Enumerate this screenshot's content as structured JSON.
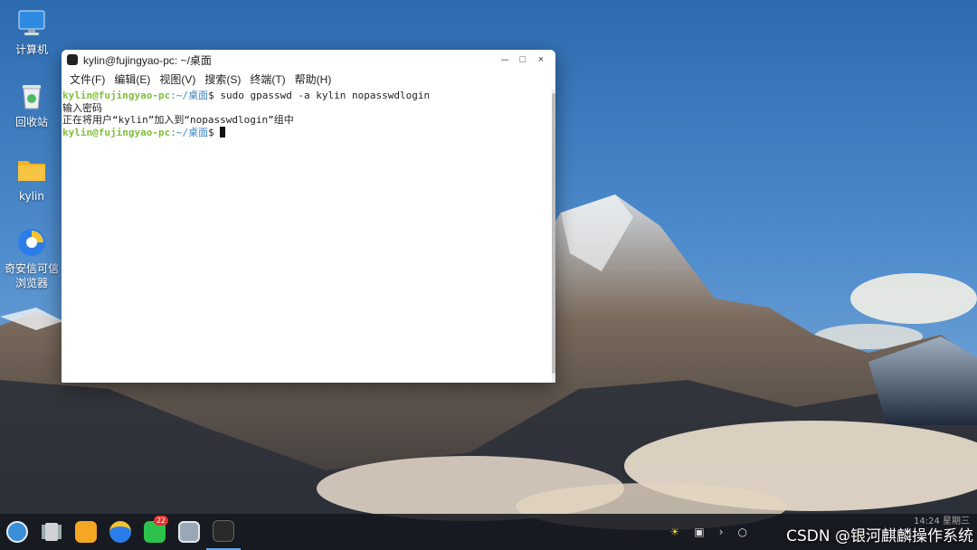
{
  "desktop": {
    "icons": [
      {
        "label": "计算机",
        "icon": "computer-icon"
      },
      {
        "label": "回收站",
        "icon": "trash-icon"
      },
      {
        "label": "kylin",
        "icon": "folder-icon"
      },
      {
        "label": "奇安信可信",
        "label2": "浏览器",
        "icon": "browser-icon"
      }
    ]
  },
  "window": {
    "title": "kylin@fujingyao-pc: ~/桌面",
    "controls": {
      "minimize": "－",
      "maximize": "□",
      "close": "×"
    },
    "menu": [
      "文件(F)",
      "编辑(E)",
      "视图(V)",
      "搜索(S)",
      "终端(T)",
      "帮助(H)"
    ]
  },
  "terminal": {
    "prompt_user": "kylin@fujingyao-pc",
    "prompt_path": ":~/桌面",
    "prompt_suffix": "$ ",
    "command": "sudo gpasswd -a kylin nopasswdlogin",
    "output_1": "输入密码",
    "output_2": "正在将用户“kylin”加入到“nopasswdlogin”组中"
  },
  "taskbar": {
    "apps": [
      {
        "name": "start-menu-icon",
        "color": "#3a8fd8"
      },
      {
        "name": "multitask-view-icon",
        "color": "#cfd3d8"
      },
      {
        "name": "file-manager-icon",
        "color": "#f5a623"
      },
      {
        "name": "browser-icon",
        "color": "#2b7de9"
      },
      {
        "name": "wechat-icon",
        "color": "#2dc24b",
        "badge": "22"
      },
      {
        "name": "image-viewer-icon",
        "color": "#9aa8b6"
      },
      {
        "name": "terminal-icon",
        "color": "#2a2a2a"
      }
    ],
    "clock_time": "14:24 星期三",
    "watermark": "CSDN @银河麒麟操作系统"
  }
}
